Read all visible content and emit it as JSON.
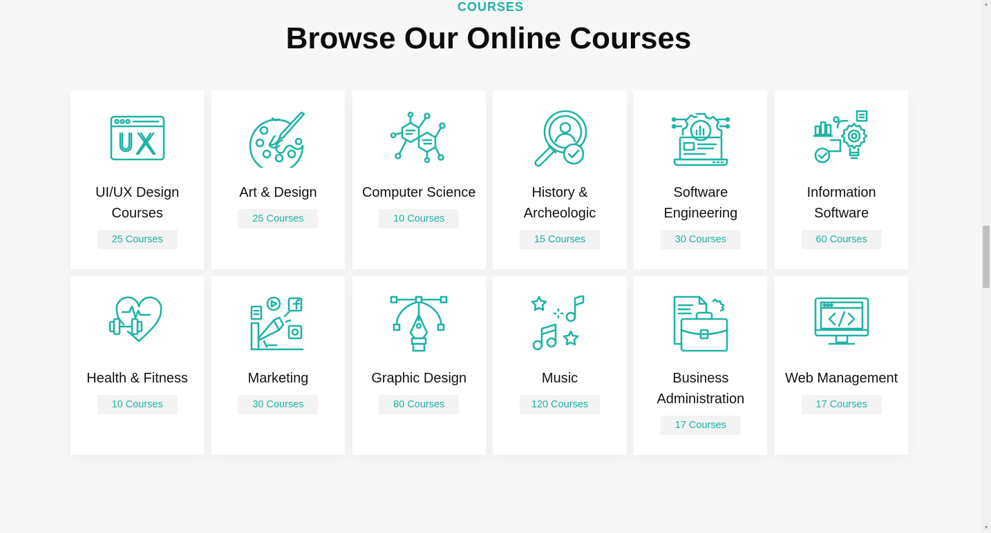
{
  "section": {
    "eyebrow": "COURSES",
    "title": "Browse Our Online Courses",
    "accent_color": "#1fb3a5"
  },
  "courses": [
    {
      "title": "UI/UX Design Courses",
      "count": "25 Courses",
      "icon": "ux-window-icon"
    },
    {
      "title": "Art & Design",
      "count": "25 Courses",
      "icon": "paint-palette-icon"
    },
    {
      "title": "Computer Science",
      "count": "10 Courses",
      "icon": "network-hexagon-icon"
    },
    {
      "title": "History & Archeologic",
      "count": "15 Courses",
      "icon": "magnifier-person-icon"
    },
    {
      "title": "Software Engineering",
      "count": "30 Courses",
      "icon": "laptop-gear-icon"
    },
    {
      "title": "Information Software",
      "count": "60 Courses",
      "icon": "bulb-gear-chart-icon"
    },
    {
      "title": "Health & Fitness",
      "count": "10 Courses",
      "icon": "heart-dumbbell-icon"
    },
    {
      "title": "Marketing",
      "count": "30 Courses",
      "icon": "megaphone-social-icon"
    },
    {
      "title": "Graphic Design",
      "count": "80 Courses",
      "icon": "pen-tool-bezier-icon"
    },
    {
      "title": "Music",
      "count": "120 Courses",
      "icon": "music-notes-stars-icon"
    },
    {
      "title": "Business Administration",
      "count": "17 Courses",
      "icon": "briefcase-document-icon"
    },
    {
      "title": "Web Management",
      "count": "17 Courses",
      "icon": "monitor-code-icon"
    }
  ]
}
